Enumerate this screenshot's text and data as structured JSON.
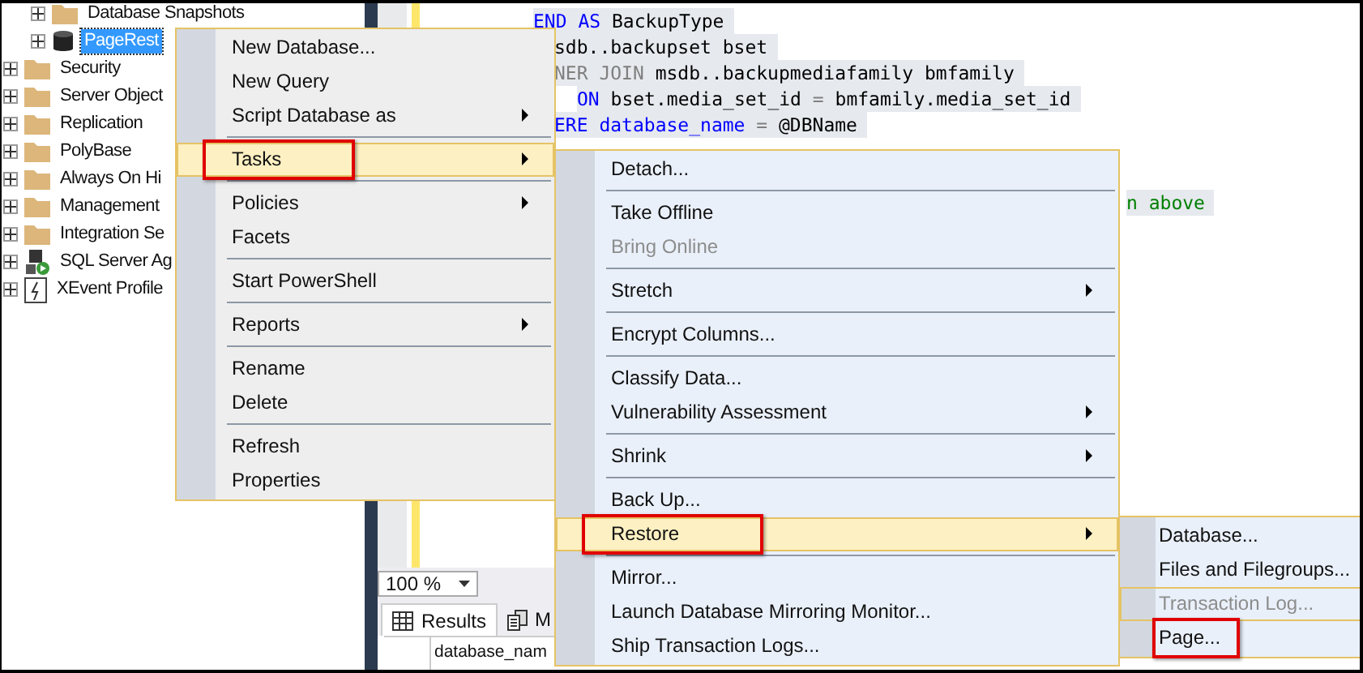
{
  "object_explorer": {
    "database_children": [
      {
        "label": "Database Snapshots",
        "kind": "folder",
        "expanded": false,
        "selected": false
      },
      {
        "label": "PageRest",
        "kind": "database",
        "expanded": false,
        "selected": true
      }
    ],
    "items": [
      {
        "label": "Security",
        "kind": "folder",
        "expanded": false,
        "selected": false
      },
      {
        "label": "Server Object",
        "kind": "folder",
        "expanded": false,
        "selected": false
      },
      {
        "label": "Replication",
        "kind": "folder",
        "expanded": false,
        "selected": false
      },
      {
        "label": "PolyBase",
        "kind": "folder",
        "expanded": false,
        "selected": false
      },
      {
        "label": "Always On Hi",
        "kind": "folder",
        "expanded": false,
        "selected": false
      },
      {
        "label": "Management",
        "kind": "folder",
        "expanded": false,
        "selected": false
      },
      {
        "label": "Integration Se",
        "kind": "folder",
        "expanded": false,
        "selected": false
      },
      {
        "label": "SQL Server Ag",
        "kind": "agent",
        "expanded": false,
        "selected": false
      },
      {
        "label": "XEvent Profile",
        "kind": "xevent",
        "expanded": false,
        "selected": false
      }
    ]
  },
  "editor": {
    "lines": [
      {
        "kind": "start",
        "segments": [
          {
            "text": "END",
            "kind": "keyword"
          },
          {
            "text": " AS",
            "kind": "keyword"
          },
          {
            "text": " BackupType",
            "kind": "plain"
          }
        ]
      },
      {
        "kind": "clipped",
        "segments": [
          {
            "text": "sdb..backupset bset",
            "kind": "plain"
          }
        ]
      },
      {
        "kind": "clipped",
        "segments": [
          {
            "text": "NER JOIN",
            "kind": "operator"
          },
          {
            "text": " msdb..backupmediafamily bmfamily",
            "kind": "plain"
          }
        ]
      },
      {
        "kind": "indented",
        "segments": [
          {
            "text": "ON",
            "kind": "keyword"
          },
          {
            "text": " bset.media_set_id",
            "kind": "plain"
          },
          {
            "text": " =",
            "kind": "operator"
          },
          {
            "text": " bmfamily.media_set_id",
            "kind": "plain"
          }
        ]
      },
      {
        "kind": "clipped",
        "segments": [
          {
            "text": "ERE",
            "kind": "keyword"
          },
          {
            "text": " database_name",
            "kind": "keyword"
          },
          {
            "text": " =",
            "kind": "operator"
          },
          {
            "text": " @DBName",
            "kind": "plain"
          }
        ]
      },
      {
        "kind": "tail",
        "segments": [
          {
            "text": "n above",
            "kind": "comment"
          }
        ]
      }
    ],
    "zoom": "100 %"
  },
  "results": {
    "tabs": [
      {
        "label": "Results",
        "selected": true
      },
      {
        "label": "M",
        "selected": false
      }
    ],
    "columns": [
      "database_nam"
    ]
  },
  "menus": [
    {
      "items": [
        {
          "label": "New Database...",
          "separator_above": false,
          "submenu": false,
          "selected": false,
          "disabled": false,
          "annotated": false
        },
        {
          "label": "New Query",
          "separator_above": false,
          "submenu": false,
          "selected": false,
          "disabled": false,
          "annotated": false
        },
        {
          "label": "Script Database as",
          "separator_above": false,
          "submenu": true,
          "selected": false,
          "disabled": false,
          "annotated": false
        },
        {
          "label": "Tasks",
          "separator_above": true,
          "submenu": true,
          "selected": true,
          "disabled": false,
          "annotated": true
        },
        {
          "label": "Policies",
          "separator_above": true,
          "submenu": true,
          "selected": false,
          "disabled": false,
          "annotated": false
        },
        {
          "label": "Facets",
          "separator_above": false,
          "submenu": false,
          "selected": false,
          "disabled": false,
          "annotated": false
        },
        {
          "label": "Start PowerShell",
          "separator_above": true,
          "submenu": false,
          "selected": false,
          "disabled": false,
          "annotated": false
        },
        {
          "label": "Reports",
          "separator_above": true,
          "submenu": true,
          "selected": false,
          "disabled": false,
          "annotated": false
        },
        {
          "label": "Rename",
          "separator_above": true,
          "submenu": false,
          "selected": false,
          "disabled": false,
          "annotated": false
        },
        {
          "label": "Delete",
          "separator_above": false,
          "submenu": false,
          "selected": false,
          "disabled": false,
          "annotated": false
        },
        {
          "label": "Refresh",
          "separator_above": true,
          "submenu": false,
          "selected": false,
          "disabled": false,
          "annotated": false
        },
        {
          "label": "Properties",
          "separator_above": false,
          "submenu": false,
          "selected": false,
          "disabled": false,
          "annotated": false
        }
      ]
    },
    {
      "items": [
        {
          "label": "Detach...",
          "separator_above": false,
          "submenu": false,
          "selected": false,
          "disabled": false,
          "annotated": false
        },
        {
          "label": "Take Offline",
          "separator_above": true,
          "submenu": false,
          "selected": false,
          "disabled": false,
          "annotated": false
        },
        {
          "label": "Bring Online",
          "separator_above": false,
          "submenu": false,
          "selected": false,
          "disabled": true,
          "annotated": false
        },
        {
          "label": "Stretch",
          "separator_above": true,
          "submenu": true,
          "selected": false,
          "disabled": false,
          "annotated": false
        },
        {
          "label": "Encrypt Columns...",
          "separator_above": true,
          "submenu": false,
          "selected": false,
          "disabled": false,
          "annotated": false
        },
        {
          "label": "Classify Data...",
          "separator_above": true,
          "submenu": false,
          "selected": false,
          "disabled": false,
          "annotated": false
        },
        {
          "label": "Vulnerability Assessment",
          "separator_above": false,
          "submenu": true,
          "selected": false,
          "disabled": false,
          "annotated": false
        },
        {
          "label": "Shrink",
          "separator_above": true,
          "submenu": true,
          "selected": false,
          "disabled": false,
          "annotated": false
        },
        {
          "label": "Back Up...",
          "separator_above": true,
          "submenu": false,
          "selected": false,
          "disabled": false,
          "annotated": false
        },
        {
          "label": "Restore",
          "separator_above": false,
          "submenu": true,
          "selected": true,
          "disabled": false,
          "annotated": true
        },
        {
          "label": "Mirror...",
          "separator_above": true,
          "submenu": false,
          "selected": false,
          "disabled": false,
          "annotated": false
        },
        {
          "label": "Launch Database Mirroring Monitor...",
          "separator_above": false,
          "submenu": false,
          "selected": false,
          "disabled": false,
          "annotated": false
        },
        {
          "label": "Ship Transaction Logs...",
          "separator_above": false,
          "submenu": false,
          "selected": false,
          "disabled": false,
          "annotated": false
        }
      ]
    },
    {
      "items": [
        {
          "label": "Database...",
          "separator_above": false,
          "submenu": false,
          "selected": false,
          "disabled": false,
          "annotated": false
        },
        {
          "label": "Files and Filegroups...",
          "separator_above": false,
          "submenu": false,
          "selected": false,
          "disabled": false,
          "annotated": false
        },
        {
          "label": "Transaction Log...",
          "separator_above": false,
          "submenu": false,
          "selected": true,
          "disabled": true,
          "annotated": false
        },
        {
          "label": "Page...",
          "separator_above": false,
          "submenu": false,
          "selected": false,
          "disabled": false,
          "annotated": true
        }
      ]
    }
  ]
}
